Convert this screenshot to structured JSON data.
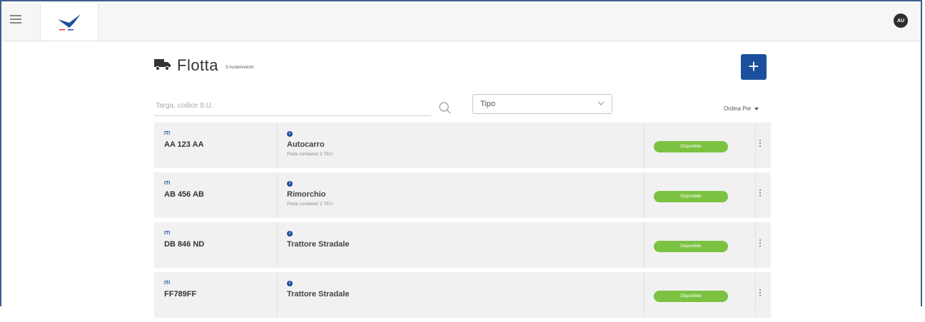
{
  "app": {
    "avatar_initials": "AU"
  },
  "page": {
    "title": "Flotta",
    "subtitle": "3 nuclei/veicoli",
    "add_label": "+"
  },
  "search": {
    "placeholder": "Targa, codice 8.U."
  },
  "filter": {
    "type_label": "Tipo"
  },
  "sort": {
    "label": "Ordina Per"
  },
  "colors": {
    "accent": "#1b4f9c",
    "status_green": "#7cc242",
    "row_bg": "#f1f1f1"
  },
  "vehicles": [
    {
      "tag": "ITI",
      "plate": "AA 123 AA",
      "type": "Autocarro",
      "desc": "Porta container 2 TEU",
      "status": "Disponibile"
    },
    {
      "tag": "ITI",
      "plate": "AB 456 AB",
      "type": "Rimorchio",
      "desc": "Porta container 2 TEU",
      "status": "Disponibile"
    },
    {
      "tag": "ITI",
      "plate": "DB 846 ND",
      "type": "Trattore Stradale",
      "desc": "",
      "status": "Disponibile"
    },
    {
      "tag": "ITI",
      "plate": "FF789FF",
      "type": "Trattore Stradale",
      "desc": "",
      "status": "Disponibile"
    }
  ]
}
